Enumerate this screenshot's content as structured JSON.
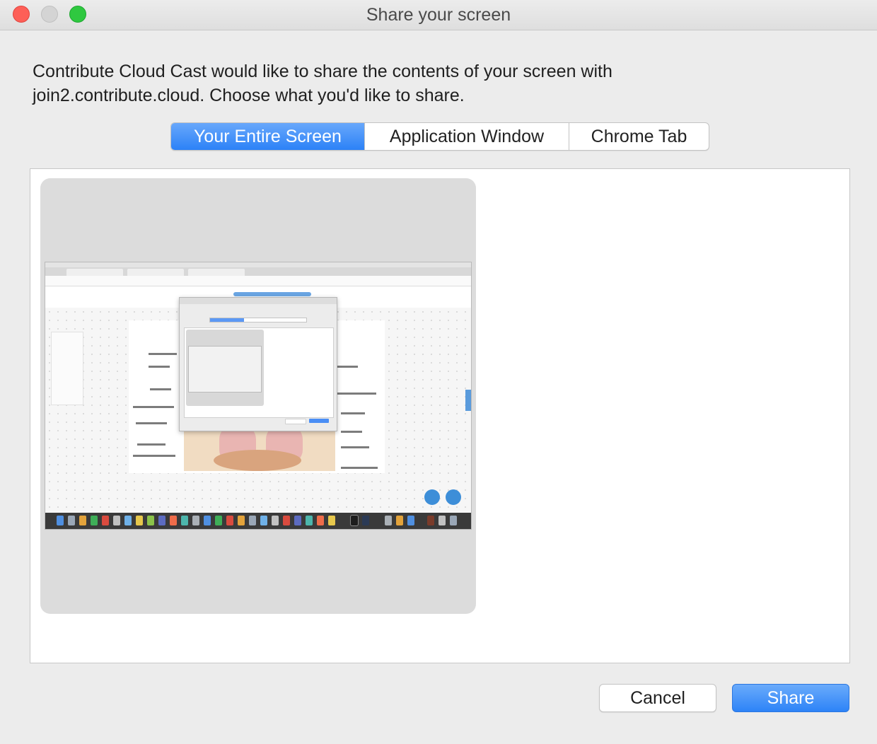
{
  "window": {
    "title": "Share your screen"
  },
  "dialog": {
    "message_line1": "Contribute Cloud Cast would like to share the contents of your screen with",
    "message_line2": "join2.contribute.cloud. Choose what you'd like to share."
  },
  "tabs": [
    {
      "label": "Your Entire Screen",
      "selected": true
    },
    {
      "label": "Application Window",
      "selected": false
    },
    {
      "label": "Chrome Tab",
      "selected": false
    }
  ],
  "buttons": {
    "cancel_label": "Cancel",
    "share_label": "Share"
  },
  "colors": {
    "accent": "#2c82f7",
    "close": "#fd5f57",
    "minimize": "#d4d4d4",
    "maximize": "#2fc840"
  }
}
